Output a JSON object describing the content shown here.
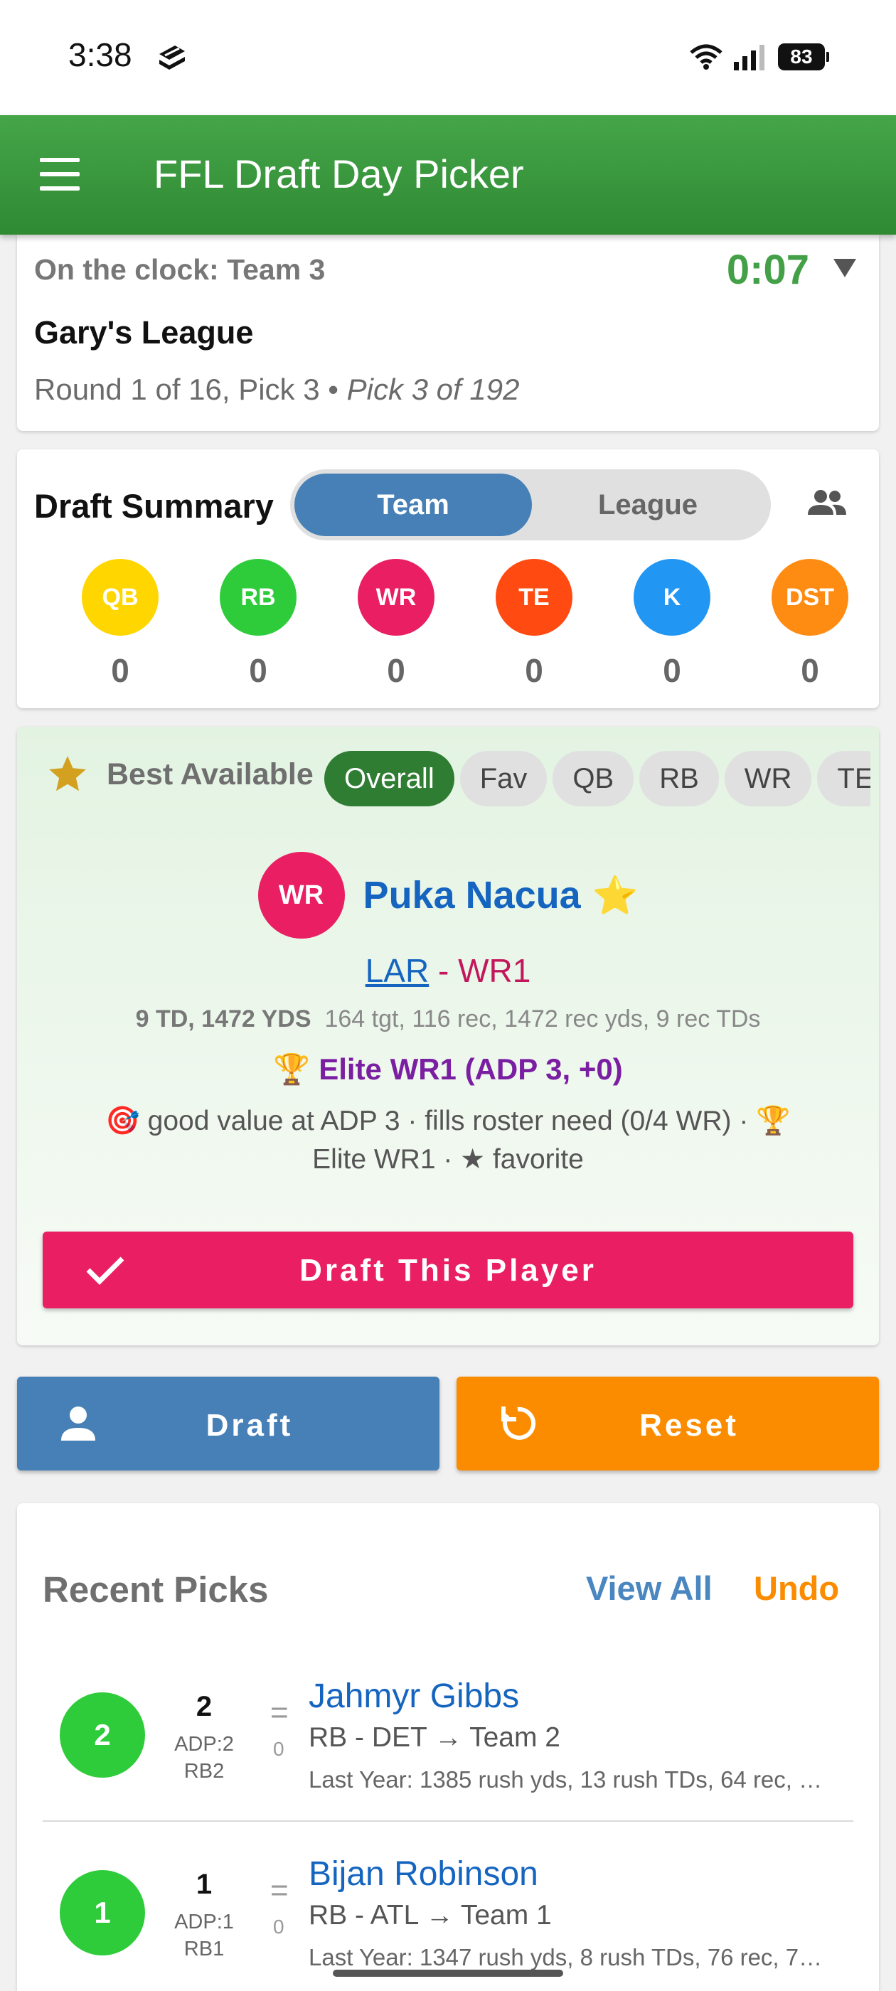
{
  "status_bar": {
    "time": "3:38",
    "battery": "83"
  },
  "app_bar": {
    "title": "FFL Draft Day Picker"
  },
  "clock": {
    "label": "On the clock: Team 3",
    "timer": "0:07",
    "league": "Gary's League",
    "round": "Round 1 of 16, Pick 3",
    "separator": " • ",
    "pick_total": "Pick 3 of 192"
  },
  "summary": {
    "title": "Draft Summary",
    "tabs": {
      "team": "Team",
      "league": "League"
    },
    "positions": [
      {
        "label": "QB",
        "count": "0",
        "color": "#ffd600"
      },
      {
        "label": "RB",
        "count": "0",
        "color": "#2ecc3b"
      },
      {
        "label": "WR",
        "count": "0",
        "color": "#e91e63"
      },
      {
        "label": "TE",
        "count": "0",
        "color": "#ff4b12"
      },
      {
        "label": "K",
        "count": "0",
        "color": "#2196f3"
      },
      {
        "label": "DST",
        "count": "0",
        "color": "#ff8c12"
      }
    ]
  },
  "best": {
    "title": "Best Available",
    "filters": [
      "Overall",
      "Fav",
      "QB",
      "RB",
      "WR",
      "TE"
    ],
    "player": {
      "pos": "WR",
      "name": "Puka Nacua",
      "fav_mark": "⭐",
      "team": "LAR",
      "dash": " - ",
      "rank": "WR1",
      "stats_bold": "9 TD, 1472 YDS",
      "stats": "164 tgt, 116 rec, 1472 rec yds, 9 rec TDs",
      "elite": "🏆 Elite WR1 (ADP 3, +0)",
      "value_note": "🎯 good value at ADP 3 · fills roster need (0/4 WR) · 🏆 Elite WR1 · ★ favorite"
    },
    "draft_button": "Draft This Player"
  },
  "actions": {
    "draft": "Draft",
    "reset": "Reset"
  },
  "recent": {
    "title": "Recent Picks",
    "view_all": "View All",
    "undo": "Undo",
    "picks": [
      {
        "circle": "2",
        "num": "2",
        "adp": "ADP:2",
        "rank": "RB2",
        "eq": "=",
        "delta": "0",
        "name": "Jahmyr Gibbs",
        "team": "RB - DET → Team 2",
        "last": "Last Year: 1385 rush yds, 13 rush TDs, 64 rec, …"
      },
      {
        "circle": "1",
        "num": "1",
        "adp": "ADP:1",
        "rank": "RB1",
        "eq": "=",
        "delta": "0",
        "name": "Bijan Robinson",
        "team": "RB - ATL → Team 1",
        "last": "Last Year: 1347 rush yds, 8 rush TDs, 76 rec, 7…"
      }
    ]
  },
  "colors": {
    "green": "#43a047",
    "pink": "#e91e63",
    "blue": "#4680b6",
    "orange": "#fb8c00"
  }
}
